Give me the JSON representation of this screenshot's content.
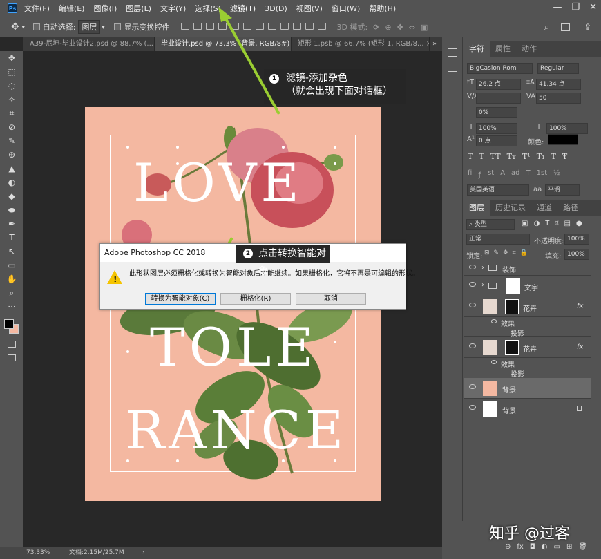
{
  "menubar": {
    "logo": "Ps",
    "items": [
      "文件(F)",
      "编辑(E)",
      "图像(I)",
      "图层(L)",
      "文字(Y)",
      "选择(S)",
      "滤镜(T)",
      "3D(D)",
      "视图(V)",
      "窗口(W)",
      "帮助(H)"
    ],
    "window_minimize": "—",
    "window_maximize": "❐",
    "window_close": "✕"
  },
  "options": {
    "auto_select_label": "自动选择:",
    "auto_select_value": "图层",
    "show_transform_label": "显示变换控件",
    "mode_3d_label": "3D 模式:"
  },
  "tabs": [
    {
      "label": "A39-尼坤-毕业设计2.psd @ 88.7% (...",
      "close": "×"
    },
    {
      "label": "毕业设计.psd @ 73.3% (背景, RGB/8#) *",
      "close": "×"
    },
    {
      "label": "矩形 1.psb @ 66.7% (矩形 1, RGB/8...",
      "close": "×"
    }
  ],
  "tools": [
    "✥",
    "⬚",
    "◌",
    "✧",
    "⌗",
    "⊘",
    "✎",
    "⊕",
    "▲",
    "◐",
    "◆",
    "⬬",
    "✒",
    "T",
    "↖",
    "▭",
    "✋",
    "⌕",
    "···"
  ],
  "poster": {
    "line1": "LOVE",
    "line2": "TOLE",
    "line3": "RANCE"
  },
  "callout1": {
    "num": "1",
    "line1": "滤镜-添加杂色",
    "line2": "（就会出现下面对话框）"
  },
  "callout2": {
    "num": "2",
    "text": "点击转换智能对象"
  },
  "dialog": {
    "title": "Adobe Photoshop CC 2018",
    "warn_mark": "!",
    "message": "此形状图层必须栅格化或转换为智能对象后才能继续。如果栅格化，它将不再是可编辑的形状。",
    "btn_convert": "转换为智能对象(C)",
    "btn_rasterize": "栅格化(R)",
    "btn_cancel": "取消"
  },
  "character_panel": {
    "tabs": [
      "字符",
      "属性",
      "动作"
    ],
    "font_family": "BigCaslon Rom",
    "font_style": "Regular",
    "font_size": "26.2 点",
    "leading": "41.34 点",
    "kerning_label": "V/A",
    "tracking_label": "VA",
    "tracking": "50",
    "scale_pct": "0%",
    "vscale_label": "IT",
    "vscale": "100%",
    "hscale_label": "T",
    "hscale": "100%",
    "baseline_label": "A¹",
    "baseline": "0 点",
    "color_label": "颜色:",
    "styles": [
      "T",
      "T",
      "TT",
      "Tт",
      "T¹",
      "T₁",
      "T",
      "Ŧ"
    ],
    "opentype": [
      "fi",
      "ꝭ",
      "st",
      "A",
      "ad",
      "T",
      "1st",
      "½"
    ],
    "language": "美国英语",
    "aa_label": "aa",
    "antialias": "平滑"
  },
  "layers_panel": {
    "tabs": [
      "图层",
      "历史记录",
      "通道",
      "路径"
    ],
    "filter": "类型",
    "filter_icons": [
      "▣",
      "◑",
      "T",
      "⌑",
      "▤",
      "●"
    ],
    "blend": "正常",
    "opacity_label": "不透明度:",
    "opacity": "100%",
    "lock_label": "锁定:",
    "lock_icons": [
      "⊠",
      "✎",
      "✥",
      "⌗",
      "🔒"
    ],
    "fill_label": "填充:",
    "fill": "100%",
    "fx": "fx",
    "layers": [
      {
        "name": "装饰"
      },
      {
        "name": "文字"
      },
      {
        "name": "花卉"
      },
      {
        "name": "效果"
      },
      {
        "name": "投影"
      },
      {
        "name": "花卉"
      },
      {
        "name": "效果"
      },
      {
        "name": "投影"
      },
      {
        "name": "背景"
      },
      {
        "name": "背景"
      }
    ],
    "footer_icons": [
      "⊖",
      "fx",
      "◘",
      "◐",
      "▭",
      "⊞",
      "🗑"
    ]
  },
  "status": {
    "zoom": "73.33%",
    "doc": "文档:2.15M/25.7M"
  },
  "watermark": "知乎 @过客"
}
